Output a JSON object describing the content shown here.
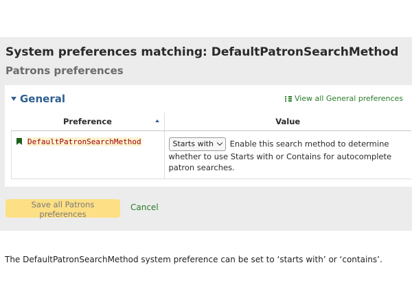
{
  "header": {
    "title": "System preferences matching: DefaultPatronSearchMethod",
    "subtitle": "Patrons preferences"
  },
  "section": {
    "title": "General",
    "caret_icon": "caret-down-icon",
    "view_all_label": "View all General preferences",
    "view_all_icon": "list-icon"
  },
  "table": {
    "columns": [
      "Preference",
      "Value"
    ],
    "sort_icon": "sort-ascending-icon",
    "rows": [
      {
        "preference": "DefaultPatronSearchMethod",
        "select_value": "Starts with",
        "description": "Enable this search method to determine whether to use Starts with or Contains for autocomplete patron searches."
      }
    ]
  },
  "actions": {
    "save_label": "Save all Patrons preferences",
    "cancel_label": "Cancel"
  },
  "caption": "The DefaultPatronSearchMethod system preference can be set to ‘starts with’ or ‘contains’.",
  "colors": {
    "panel_bg": "#ececec",
    "section_title": "#2f5f8f",
    "link_green": "#2a7a2a",
    "save_button": "#fddf85",
    "pref_code": "#a00000"
  }
}
